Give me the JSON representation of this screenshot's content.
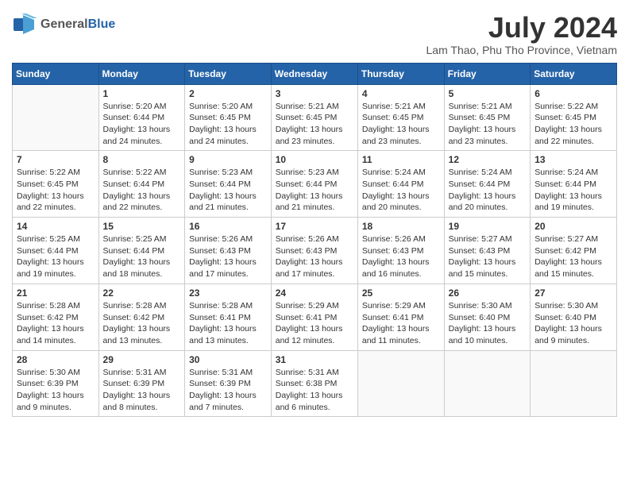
{
  "header": {
    "logo_general": "General",
    "logo_blue": "Blue",
    "month_title": "July 2024",
    "location": "Lam Thao, Phu Tho Province, Vietnam"
  },
  "days_of_week": [
    "Sunday",
    "Monday",
    "Tuesday",
    "Wednesday",
    "Thursday",
    "Friday",
    "Saturday"
  ],
  "weeks": [
    [
      {
        "day": "",
        "info": ""
      },
      {
        "day": "1",
        "info": "Sunrise: 5:20 AM\nSunset: 6:44 PM\nDaylight: 13 hours\nand 24 minutes."
      },
      {
        "day": "2",
        "info": "Sunrise: 5:20 AM\nSunset: 6:45 PM\nDaylight: 13 hours\nand 24 minutes."
      },
      {
        "day": "3",
        "info": "Sunrise: 5:21 AM\nSunset: 6:45 PM\nDaylight: 13 hours\nand 23 minutes."
      },
      {
        "day": "4",
        "info": "Sunrise: 5:21 AM\nSunset: 6:45 PM\nDaylight: 13 hours\nand 23 minutes."
      },
      {
        "day": "5",
        "info": "Sunrise: 5:21 AM\nSunset: 6:45 PM\nDaylight: 13 hours\nand 23 minutes."
      },
      {
        "day": "6",
        "info": "Sunrise: 5:22 AM\nSunset: 6:45 PM\nDaylight: 13 hours\nand 22 minutes."
      }
    ],
    [
      {
        "day": "7",
        "info": "Sunrise: 5:22 AM\nSunset: 6:45 PM\nDaylight: 13 hours\nand 22 minutes."
      },
      {
        "day": "8",
        "info": "Sunrise: 5:22 AM\nSunset: 6:44 PM\nDaylight: 13 hours\nand 22 minutes."
      },
      {
        "day": "9",
        "info": "Sunrise: 5:23 AM\nSunset: 6:44 PM\nDaylight: 13 hours\nand 21 minutes."
      },
      {
        "day": "10",
        "info": "Sunrise: 5:23 AM\nSunset: 6:44 PM\nDaylight: 13 hours\nand 21 minutes."
      },
      {
        "day": "11",
        "info": "Sunrise: 5:24 AM\nSunset: 6:44 PM\nDaylight: 13 hours\nand 20 minutes."
      },
      {
        "day": "12",
        "info": "Sunrise: 5:24 AM\nSunset: 6:44 PM\nDaylight: 13 hours\nand 20 minutes."
      },
      {
        "day": "13",
        "info": "Sunrise: 5:24 AM\nSunset: 6:44 PM\nDaylight: 13 hours\nand 19 minutes."
      }
    ],
    [
      {
        "day": "14",
        "info": "Sunrise: 5:25 AM\nSunset: 6:44 PM\nDaylight: 13 hours\nand 19 minutes."
      },
      {
        "day": "15",
        "info": "Sunrise: 5:25 AM\nSunset: 6:44 PM\nDaylight: 13 hours\nand 18 minutes."
      },
      {
        "day": "16",
        "info": "Sunrise: 5:26 AM\nSunset: 6:43 PM\nDaylight: 13 hours\nand 17 minutes."
      },
      {
        "day": "17",
        "info": "Sunrise: 5:26 AM\nSunset: 6:43 PM\nDaylight: 13 hours\nand 17 minutes."
      },
      {
        "day": "18",
        "info": "Sunrise: 5:26 AM\nSunset: 6:43 PM\nDaylight: 13 hours\nand 16 minutes."
      },
      {
        "day": "19",
        "info": "Sunrise: 5:27 AM\nSunset: 6:43 PM\nDaylight: 13 hours\nand 15 minutes."
      },
      {
        "day": "20",
        "info": "Sunrise: 5:27 AM\nSunset: 6:42 PM\nDaylight: 13 hours\nand 15 minutes."
      }
    ],
    [
      {
        "day": "21",
        "info": "Sunrise: 5:28 AM\nSunset: 6:42 PM\nDaylight: 13 hours\nand 14 minutes."
      },
      {
        "day": "22",
        "info": "Sunrise: 5:28 AM\nSunset: 6:42 PM\nDaylight: 13 hours\nand 13 minutes."
      },
      {
        "day": "23",
        "info": "Sunrise: 5:28 AM\nSunset: 6:41 PM\nDaylight: 13 hours\nand 13 minutes."
      },
      {
        "day": "24",
        "info": "Sunrise: 5:29 AM\nSunset: 6:41 PM\nDaylight: 13 hours\nand 12 minutes."
      },
      {
        "day": "25",
        "info": "Sunrise: 5:29 AM\nSunset: 6:41 PM\nDaylight: 13 hours\nand 11 minutes."
      },
      {
        "day": "26",
        "info": "Sunrise: 5:30 AM\nSunset: 6:40 PM\nDaylight: 13 hours\nand 10 minutes."
      },
      {
        "day": "27",
        "info": "Sunrise: 5:30 AM\nSunset: 6:40 PM\nDaylight: 13 hours\nand 9 minutes."
      }
    ],
    [
      {
        "day": "28",
        "info": "Sunrise: 5:30 AM\nSunset: 6:39 PM\nDaylight: 13 hours\nand 9 minutes."
      },
      {
        "day": "29",
        "info": "Sunrise: 5:31 AM\nSunset: 6:39 PM\nDaylight: 13 hours\nand 8 minutes."
      },
      {
        "day": "30",
        "info": "Sunrise: 5:31 AM\nSunset: 6:39 PM\nDaylight: 13 hours\nand 7 minutes."
      },
      {
        "day": "31",
        "info": "Sunrise: 5:31 AM\nSunset: 6:38 PM\nDaylight: 13 hours\nand 6 minutes."
      },
      {
        "day": "",
        "info": ""
      },
      {
        "day": "",
        "info": ""
      },
      {
        "day": "",
        "info": ""
      }
    ]
  ]
}
